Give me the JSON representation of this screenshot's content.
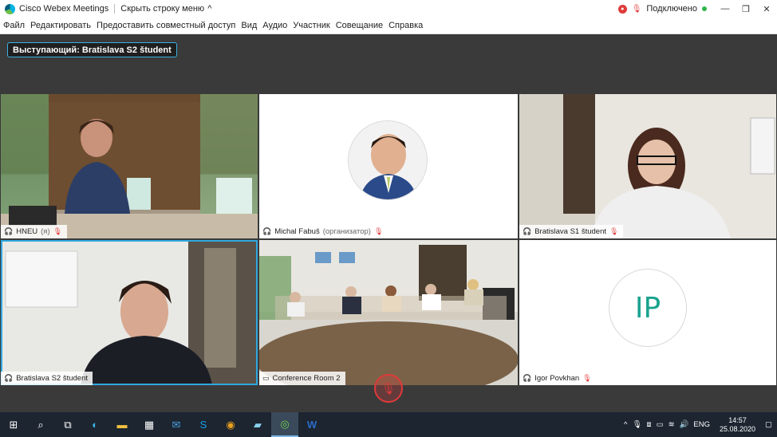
{
  "window": {
    "app_title": "Cisco Webex Meetings",
    "hide_menu_label": "Скрыть строку меню",
    "status": "Подключено"
  },
  "menu": [
    "Файл",
    "Редактировать",
    "Предоставить совместный доступ",
    "Вид",
    "Аудио",
    "Участник",
    "Совещание",
    "Справка"
  ],
  "speaker_banner": "Выступающий: Bratislava S2 študent",
  "tiles": [
    {
      "name": "HNEU",
      "suffix": "(я)"
    },
    {
      "name": "Michal Fabuš",
      "suffix": "(организатор)"
    },
    {
      "name": "Bratislava S1 študent",
      "suffix": ""
    },
    {
      "name": "Bratislava S2 študent",
      "suffix": ""
    },
    {
      "name": "Conference Room 2",
      "suffix": ""
    },
    {
      "name": "Igor Povkhan",
      "suffix": ""
    }
  ],
  "ip_initials": "IP",
  "taskbar": {
    "language": "ENG",
    "time": "14:57",
    "date": "25.08.2020"
  },
  "colors": {
    "accent_blue": "#2fa8e0",
    "mute_red": "#e03a3a",
    "connected_green": "#2fb44a",
    "initials_teal": "#1aa38f"
  }
}
